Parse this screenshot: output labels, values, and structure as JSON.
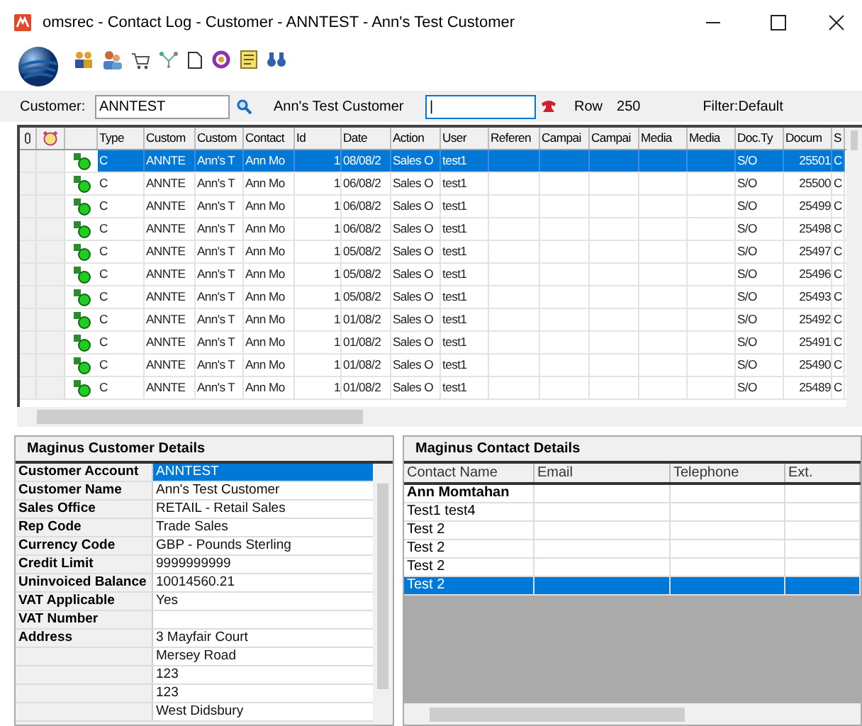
{
  "window": {
    "title": "omsrec - Contact Log - Customer - ANNTEST - Ann's Test Customer"
  },
  "customer_bar": {
    "customer_label": "Customer:",
    "customer_value": "ANNTEST",
    "customer_name": "Ann's Test Customer",
    "phone_search_value": "|",
    "row_label": "Row",
    "row_value": "250",
    "filter": "Filter:Default"
  },
  "log_table": {
    "columns": [
      "Type",
      "Custom",
      "Custom",
      "Contact",
      "Id",
      "Date",
      "Action",
      "User",
      "Referen",
      "Campai",
      "Campai",
      "Media",
      "Media",
      "Doc.Ty",
      "Docum",
      "S"
    ],
    "rows": [
      {
        "selected": true,
        "cells": [
          "C",
          "ANNTE",
          "Ann's T",
          "Ann Mo",
          "1",
          "08/08/2",
          "Sales O",
          "test1",
          null,
          null,
          null,
          null,
          null,
          "S/O",
          "25501",
          "C"
        ]
      },
      {
        "selected": false,
        "cells": [
          "C",
          "ANNTE",
          "Ann's T",
          "Ann Mo",
          "1",
          "06/08/2",
          "Sales O",
          "test1",
          null,
          null,
          null,
          null,
          null,
          "S/O",
          "25500",
          "C"
        ]
      },
      {
        "selected": false,
        "cells": [
          "C",
          "ANNTE",
          "Ann's T",
          "Ann Mo",
          "1",
          "06/08/2",
          "Sales O",
          "test1",
          null,
          null,
          null,
          null,
          null,
          "S/O",
          "25499",
          "C"
        ]
      },
      {
        "selected": false,
        "cells": [
          "C",
          "ANNTE",
          "Ann's T",
          "Ann Mo",
          "1",
          "06/08/2",
          "Sales O",
          "test1",
          null,
          null,
          null,
          null,
          null,
          "S/O",
          "25498",
          "C"
        ]
      },
      {
        "selected": false,
        "cells": [
          "C",
          "ANNTE",
          "Ann's T",
          "Ann Mo",
          "1",
          "05/08/2",
          "Sales O",
          "test1",
          null,
          null,
          null,
          null,
          null,
          "S/O",
          "25497",
          "C"
        ]
      },
      {
        "selected": false,
        "cells": [
          "C",
          "ANNTE",
          "Ann's T",
          "Ann Mo",
          "1",
          "05/08/2",
          "Sales O",
          "test1",
          null,
          null,
          null,
          null,
          null,
          "S/O",
          "25496",
          "C"
        ]
      },
      {
        "selected": false,
        "cells": [
          "C",
          "ANNTE",
          "Ann's T",
          "Ann Mo",
          "1",
          "05/08/2",
          "Sales O",
          "test1",
          null,
          null,
          null,
          null,
          null,
          "S/O",
          "25493",
          "C"
        ]
      },
      {
        "selected": false,
        "cells": [
          "C",
          "ANNTE",
          "Ann's T",
          "Ann Mo",
          "1",
          "01/08/2",
          "Sales O",
          "test1",
          null,
          null,
          null,
          null,
          null,
          "S/O",
          "25492",
          "C"
        ]
      },
      {
        "selected": false,
        "cells": [
          "C",
          "ANNTE",
          "Ann's T",
          "Ann Mo",
          "1",
          "01/08/2",
          "Sales O",
          "test1",
          null,
          null,
          null,
          null,
          null,
          "S/O",
          "25491",
          "C"
        ]
      },
      {
        "selected": false,
        "cells": [
          "C",
          "ANNTE",
          "Ann's T",
          "Ann Mo",
          "1",
          "01/08/2",
          "Sales O",
          "test1",
          null,
          null,
          null,
          null,
          null,
          "S/O",
          "25490",
          "C"
        ]
      },
      {
        "selected": false,
        "cells": [
          "C",
          "ANNTE",
          "Ann's T",
          "Ann Mo",
          "1",
          "01/08/2",
          "Sales O",
          "test1",
          null,
          null,
          null,
          null,
          null,
          "S/O",
          "25489",
          "C"
        ]
      }
    ]
  },
  "customer_details": {
    "title": "Maginus Customer Details",
    "rows": [
      {
        "label": "Customer Account",
        "value": "ANNTEST",
        "selected": true
      },
      {
        "label": "Customer Name",
        "value": "Ann's Test Customer",
        "selected": false
      },
      {
        "label": "Sales Office",
        "value": "RETAIL - Retail Sales",
        "selected": false
      },
      {
        "label": "Rep Code",
        "value": "Trade Sales",
        "selected": false
      },
      {
        "label": "Currency Code",
        "value": "GBP - Pounds Sterling",
        "selected": false
      },
      {
        "label": "Credit Limit",
        "value": "9999999999",
        "selected": false
      },
      {
        "label": "Uninvoiced Balance",
        "value": "10014560.21",
        "selected": false
      },
      {
        "label": "VAT Applicable",
        "value": "Yes",
        "selected": false
      },
      {
        "label": "VAT Number",
        "selected": false
      },
      {
        "label": "Address",
        "value": "3 Mayfair Court",
        "selected": false
      },
      {
        "value": "Mersey Road",
        "selected": false
      },
      {
        "value": "123",
        "selected": false
      },
      {
        "value": "123",
        "selected": false
      },
      {
        "value": "West Didsbury",
        "selected": false
      }
    ]
  },
  "contact_details": {
    "title": "Maginus Contact Details",
    "columns": [
      "Contact Name",
      "Email",
      "Telephone",
      "Ext."
    ],
    "rows": [
      {
        "name": "Ann Momtahan",
        "primary": true,
        "selected": false
      },
      {
        "name": "Test1 test4",
        "primary": false,
        "selected": false
      },
      {
        "name": "Test 2",
        "primary": false,
        "selected": false
      },
      {
        "name": "Test 2",
        "primary": false,
        "selected": false
      },
      {
        "name": "Test 2",
        "primary": false,
        "selected": false
      },
      {
        "name": "Test 2",
        "primary": false,
        "selected": true
      }
    ]
  }
}
